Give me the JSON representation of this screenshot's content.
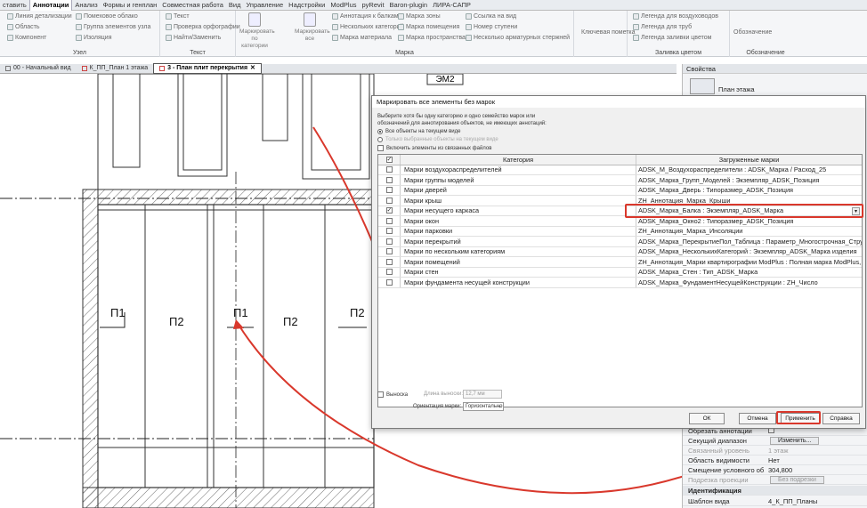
{
  "ribbon": {
    "tabs": [
      "ставить",
      "Аннотации",
      "Анализ",
      "Формы и генплан",
      "Совместная работа",
      "Вид",
      "Управление",
      "Надстройки",
      "ModPlus",
      "pyRevit",
      "Baron-plugin",
      "ЛИРА-САПР"
    ],
    "active_tab": "Аннотации",
    "groups": {
      "uzel": {
        "label": "Узел",
        "items": [
          "Линия детализации",
          "Область",
          "Компонент",
          "Помеховое облако",
          "Группа элементов узла",
          "Изоляция"
        ]
      },
      "text": {
        "label": "Текст",
        "items": [
          "Текст",
          "Проверка орфографии",
          "Найти/Заменить"
        ]
      },
      "marka": {
        "label": "Марка",
        "big_buttons": [
          "Маркировать по категории",
          "Маркировать все"
        ],
        "items": [
          "Аннотация к балкам",
          "Нескольких категорий",
          "Марка материала",
          "Марка зоны",
          "Марка помещения",
          "Марка пространства",
          "Ссылка на вид",
          "Номер ступени",
          "Несколько арматурных стержней"
        ]
      },
      "key": {
        "label": "Ключевая пометка"
      },
      "fill": {
        "label": "Заливка цветом",
        "items": [
          "Легенда для воздуховодов",
          "Легенда для труб",
          "Легенда заливки цветом"
        ]
      },
      "designation": {
        "label": "Обозначение",
        "items": [
          "Обозначение"
        ]
      }
    }
  },
  "doc_tabs": [
    {
      "label": "00 - Начальный вид",
      "active": false
    },
    {
      "label": "К_ПП_План 1 этажа",
      "active": false
    },
    {
      "label": "3 - План плит перекрытия",
      "active": true
    }
  ],
  "drawing": {
    "labels": [
      "П1",
      "П2",
      "П1",
      "П2",
      "П2"
    ],
    "top_label": "ЭМ2"
  },
  "properties": {
    "title": "Свойства",
    "type_label": "План этажа",
    "rows": [
      {
        "key": "Обрезать аннотации",
        "value": "",
        "dim": false
      },
      {
        "key": "Секущий диапазон",
        "value": "Изменить...",
        "dim": false,
        "button": true
      },
      {
        "key": "Связанный уровень",
        "value": "1 этаж",
        "dim": true
      },
      {
        "key": "Область видимости",
        "value": "Нет",
        "dim": false
      },
      {
        "key": "Смещение условного об...",
        "value": "304,800",
        "dim": false
      },
      {
        "key": "Подрезка проекции",
        "value": "Без подрезки",
        "dim": true,
        "button": true
      }
    ],
    "section": "Идентификация",
    "last_row": {
      "key": "Шаблон вида",
      "value": "4_К_ПП_Планы"
    }
  },
  "dialog": {
    "title": "Маркировать все элементы без марок",
    "intro": "Выберите хотя бы одну категорию и одно семейство марок или обозначений для аннотирования объектов, не имеющих аннотаций:",
    "radio_all": "Все объекты на текущем виде",
    "radio_selected": "Только выбранные объекты на текущем виде",
    "include_linked": "Включить элементы из связанных файлов",
    "columns": [
      "Категория",
      "Загруженные марки"
    ],
    "rows": [
      {
        "category": "Марки воздухораспределителей",
        "tag": "ADSK_M_Воздухораспределители : ADSK_Марка / Расход_25",
        "checked": false
      },
      {
        "category": "Марки группы моделей",
        "tag": "ADSK_Марка_Групп_Моделей : Экземпляр_ADSK_Позиция",
        "checked": false
      },
      {
        "category": "Марки дверей",
        "tag": "ADSK_Марка_Дверь : Типоразмер_ADSK_Позиция",
        "checked": false
      },
      {
        "category": "Марки крыш",
        "tag": "ZH_Аннотация_Марка_Крыши",
        "checked": false
      },
      {
        "category": "Марки несущего каркаса",
        "tag": "ADSK_Марка_Балка : Экземпляр_ADSK_Марка",
        "checked": true,
        "selected": true
      },
      {
        "category": "Марки окон",
        "tag": "ADSK_Марка_Окно2 : Типоразмер_ADSK_Позиция",
        "checked": false
      },
      {
        "category": "Марки парковки",
        "tag": "ZH_Аннотация_Марка_Инсоляции",
        "checked": false
      },
      {
        "category": "Марки перекрытий",
        "tag": "ADSK_Марка_ПерекрытиеПол_Таблица : Параметр_Многострочная_Структу",
        "checked": false
      },
      {
        "category": "Марки по нескольким категориям",
        "tag": "ADSK_Марка_НесколькихКатегорий : Экземпляр_ADSK_Марка изделия",
        "checked": false
      },
      {
        "category": "Марки помещений",
        "tag": "ZH_Аннотация_Марки квартирографии ModPlus : Полная марка ModPlus, пл",
        "checked": false
      },
      {
        "category": "Марки стен",
        "tag": "ADSK_Марка_Стен : Тип_ADSK_Марка",
        "checked": false
      },
      {
        "category": "Марки фундамента несущей конструкции",
        "tag": "ADSK_Марка_ФундаментНесущейКонструкции : ZH_Число",
        "checked": false
      }
    ],
    "leader_label": "Выноска",
    "leader_length_label": "Длина выноски:",
    "leader_length_value": "12,7 мм",
    "orientation_label": "Ориентация марки:",
    "orientation_value": "Горизонтально",
    "buttons": {
      "ok": "ОК",
      "cancel": "Отмена",
      "apply": "Применить",
      "help": "Справка"
    }
  },
  "colors": {
    "accent_red": "#d9382c",
    "ribbon_bg": "#f5f6f8",
    "hatch": "#444444"
  }
}
